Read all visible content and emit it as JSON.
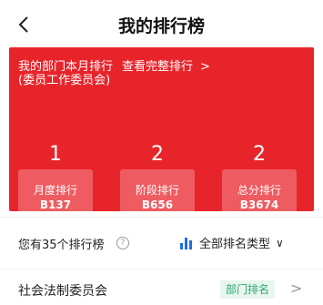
{
  "header": {
    "back_icon": "chevron-left-icon",
    "title": "我的排行榜"
  },
  "banner": {
    "bg_color": "#e8242b",
    "line1": "我的部门本月排行",
    "line2": "(委员工作委员会)",
    "link_label": "查看完整排行",
    "link_icon": "chevron-right-icon",
    "link_chevron": ">",
    "cards": [
      {
        "rank": "1",
        "label": "月度排行",
        "code": "B137"
      },
      {
        "rank": "2",
        "label": "阶段排行",
        "code": "B656"
      },
      {
        "rank": "2",
        "label": "总分排行",
        "code": "B3674"
      }
    ]
  },
  "summary": {
    "text": "您有35个排行榜",
    "help_icon": "help-circle-icon",
    "help_glyph": "?",
    "filter_icon": "bar-chart-icon",
    "filter_label": "全部排名类型",
    "filter_chevron": "∨",
    "accent_color": "#1e6fe0"
  },
  "list": {
    "items": [
      {
        "name": "社会法制委员会",
        "tag": "部门排名",
        "tag_color": "#2eaa6e",
        "chevron": ">"
      }
    ]
  }
}
